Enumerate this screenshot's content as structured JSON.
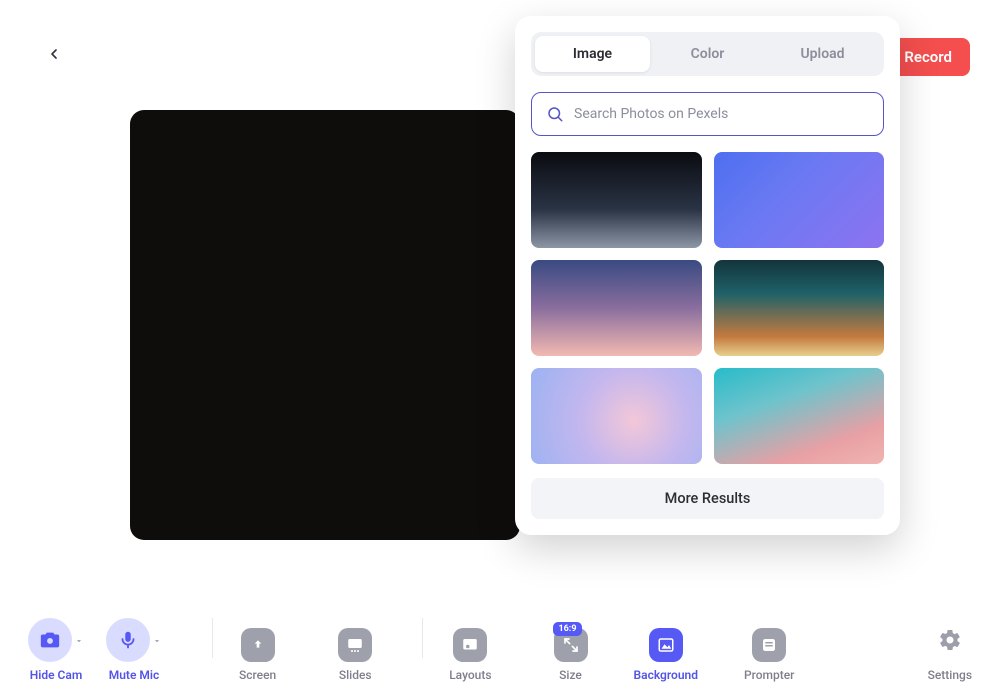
{
  "header": {
    "record_label": "Record"
  },
  "popover": {
    "tabs": {
      "image": "Image",
      "color": "Color",
      "upload": "Upload"
    },
    "search_placeholder": "Search Photos on Pexels",
    "more_label": "More Results"
  },
  "toolbar": {
    "hide_cam": "Hide Cam",
    "mute_mic": "Mute Mic",
    "screen": "Screen",
    "slides": "Slides",
    "layouts": "Layouts",
    "size": "Size",
    "size_badge": "16:9",
    "background": "Background",
    "prompter": "Prompter",
    "settings": "Settings"
  }
}
